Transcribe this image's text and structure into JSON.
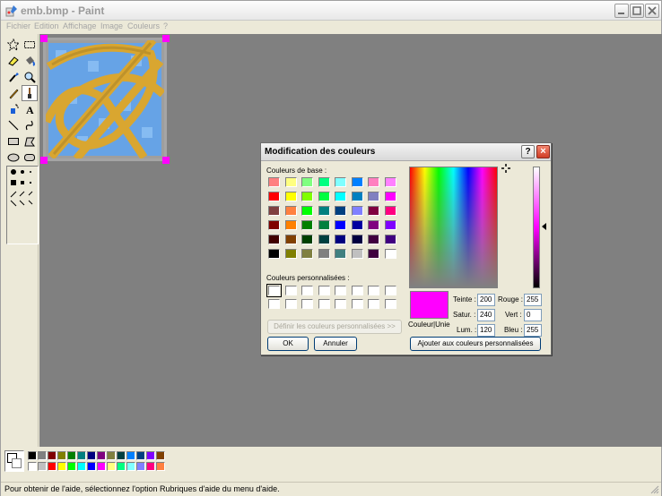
{
  "window": {
    "title": "emb.bmp - Paint",
    "min_icon": "minimize-icon",
    "max_icon": "maximize-icon",
    "close_icon": "close-icon"
  },
  "menu": [
    "Fichier",
    "Edition",
    "Affichage",
    "Image",
    "Couleurs",
    "?"
  ],
  "status": "Pour obtenir de l'aide, sélectionnez l'option Rubriques d'aide du menu d'aide.",
  "palette": {
    "top": [
      "#000000",
      "#808080",
      "#800000",
      "#808000",
      "#008000",
      "#008080",
      "#000080",
      "#800080",
      "#808040",
      "#004040",
      "#0080ff",
      "#004080",
      "#8000ff",
      "#804000"
    ],
    "bottom": [
      "#ffffff",
      "#c0c0c0",
      "#ff0000",
      "#ffff00",
      "#00ff00",
      "#00ffff",
      "#0000ff",
      "#ff00ff",
      "#ffff80",
      "#00ff80",
      "#80ffff",
      "#8080ff",
      "#ff0080",
      "#ff8040"
    ]
  },
  "dialog": {
    "title": "Modification des couleurs",
    "basic_label": "Couleurs de base :",
    "custom_label": "Couleurs personnalisées :",
    "define_button": "Définir les couleurs personnalisées >>",
    "ok": "OK",
    "cancel": "Annuler",
    "add_custom": "Ajouter aux couleurs personnalisées",
    "preview_label": "Couleur|Unie",
    "selected_color": "#ff00ff",
    "fields": {
      "hue_label": "Teinte :",
      "hue": "200",
      "sat_label": "Satur. :",
      "sat": "240",
      "lum_label": "Lum. :",
      "lum": "120",
      "red_label": "Rouge :",
      "red": "255",
      "green_label": "Vert :",
      "green": "0",
      "blue_label": "Bleu :",
      "blue": "255"
    },
    "basic_colors": [
      [
        "#ff8080",
        "#ffff80",
        "#80ff80",
        "#00ff80",
        "#80ffff",
        "#0080ff",
        "#ff80c0",
        "#ff80ff"
      ],
      [
        "#ff0000",
        "#ffff00",
        "#80ff00",
        "#00ff40",
        "#00ffff",
        "#0080c0",
        "#8080c0",
        "#ff00ff"
      ],
      [
        "#804040",
        "#ff8040",
        "#00ff00",
        "#008080",
        "#004080",
        "#8080ff",
        "#800040",
        "#ff0080"
      ],
      [
        "#800000",
        "#ff8000",
        "#008000",
        "#008040",
        "#0000ff",
        "#0000a0",
        "#800080",
        "#8000ff"
      ],
      [
        "#400000",
        "#804000",
        "#004000",
        "#004040",
        "#000080",
        "#000040",
        "#400040",
        "#400080"
      ],
      [
        "#000000",
        "#808000",
        "#808040",
        "#808080",
        "#408080",
        "#c0c0c0",
        "#400040",
        "#ffffff"
      ]
    ]
  }
}
